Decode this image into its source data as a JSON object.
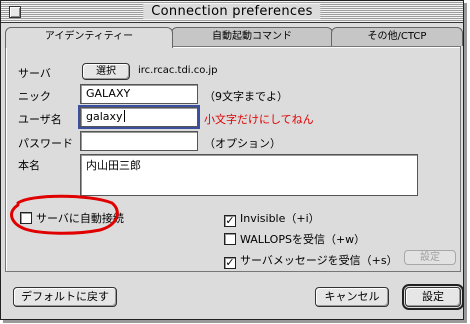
{
  "window": {
    "title": "Connection preferences"
  },
  "tabs": [
    {
      "label": "アイデンティティー"
    },
    {
      "label": "自動起動コマンド"
    },
    {
      "label": "その他/CTCP"
    }
  ],
  "server": {
    "label": "サーバ",
    "select_button": "選択",
    "value": "irc.rcac.tdi.co.jp"
  },
  "nick": {
    "label": "ニック",
    "value": "GALAXY",
    "hint": "（9文字までよ）"
  },
  "username": {
    "label": "ユーザ名",
    "value": "galaxy",
    "hint": "小文字だけにしてねん"
  },
  "password": {
    "label": "パスワード",
    "value": "",
    "hint": "（オプション）"
  },
  "realname": {
    "label": "本名",
    "value": "内山田三郎"
  },
  "checkboxes": {
    "autoconnect": {
      "label": "サーバに自動接続",
      "checked": false
    },
    "invisible": {
      "label": "Invisible（+i）",
      "checked": true
    },
    "wallops": {
      "label": "WALLOPSを受信（+w）",
      "checked": false
    },
    "server_messages": {
      "label": "サーバメッセージを受信（+s）",
      "checked": true
    }
  },
  "panel_buttons": {
    "settings": "設定"
  },
  "footer": {
    "defaults": "デフォルトに戻す",
    "cancel": "キャンセル",
    "ok": "設定"
  },
  "colors": {
    "annotation": "#e00000",
    "focus": "#3b4fa0"
  }
}
